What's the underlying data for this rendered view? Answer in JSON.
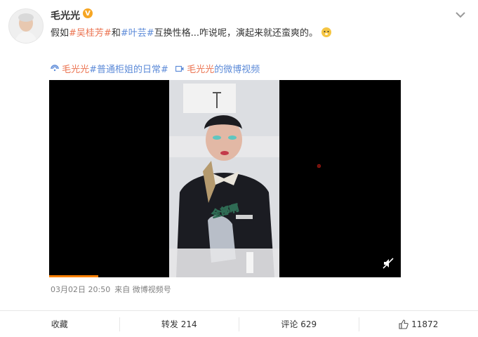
{
  "user": {
    "name": "毛光光",
    "badge_label": "V"
  },
  "post": {
    "segments": [
      {
        "text": "假如",
        "style": "plain"
      },
      {
        "text": "#吴桂芳#",
        "style": "tag"
      },
      {
        "text": "和",
        "style": "plain"
      },
      {
        "text": "#叶芸#",
        "style": "tag-blue"
      },
      {
        "text": "互换性格...咋说呢，演起来就还蛮爽的。",
        "style": "plain"
      }
    ],
    "emoji_icon": "dog-emoji-icon"
  },
  "video_line": {
    "topic_name_1": "毛光光",
    "topic_text_1": "#普通柜姐的日常#",
    "video_name": "毛光光",
    "video_suffix": "的微博视频"
  },
  "video": {
    "progress_fraction": 0.14,
    "watermark": "⊕",
    "subtitle": "全部啊",
    "icon": "mute-icon"
  },
  "meta": {
    "time": "03月02日 20:50",
    "source": "来自 微博视频号"
  },
  "footer": {
    "favorite": "收藏",
    "repost": "转发 214",
    "comment": "评论 629",
    "likes": "11872"
  },
  "colors": {
    "accent": "#eb7350",
    "link": "#5d8bd8",
    "progress": "#ff8200"
  }
}
